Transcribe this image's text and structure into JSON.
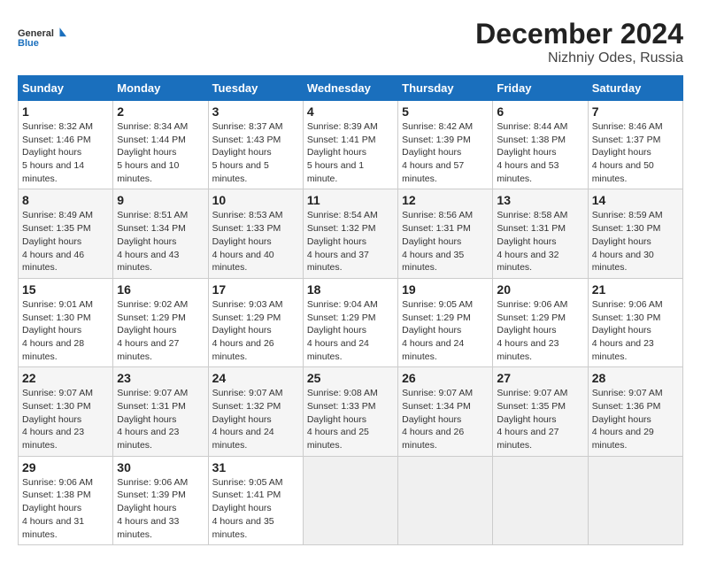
{
  "logo": {
    "line1": "General",
    "line2": "Blue"
  },
  "title": "December 2024",
  "subtitle": "Nizhniy Odes, Russia",
  "weekdays": [
    "Sunday",
    "Monday",
    "Tuesday",
    "Wednesday",
    "Thursday",
    "Friday",
    "Saturday"
  ],
  "weeks": [
    [
      {
        "day": "1",
        "sunrise": "8:32 AM",
        "sunset": "1:46 PM",
        "daylight": "5 hours and 14 minutes."
      },
      {
        "day": "2",
        "sunrise": "8:34 AM",
        "sunset": "1:44 PM",
        "daylight": "5 hours and 10 minutes."
      },
      {
        "day": "3",
        "sunrise": "8:37 AM",
        "sunset": "1:43 PM",
        "daylight": "5 hours and 5 minutes."
      },
      {
        "day": "4",
        "sunrise": "8:39 AM",
        "sunset": "1:41 PM",
        "daylight": "5 hours and 1 minute."
      },
      {
        "day": "5",
        "sunrise": "8:42 AM",
        "sunset": "1:39 PM",
        "daylight": "4 hours and 57 minutes."
      },
      {
        "day": "6",
        "sunrise": "8:44 AM",
        "sunset": "1:38 PM",
        "daylight": "4 hours and 53 minutes."
      },
      {
        "day": "7",
        "sunrise": "8:46 AM",
        "sunset": "1:37 PM",
        "daylight": "4 hours and 50 minutes."
      }
    ],
    [
      {
        "day": "8",
        "sunrise": "8:49 AM",
        "sunset": "1:35 PM",
        "daylight": "4 hours and 46 minutes."
      },
      {
        "day": "9",
        "sunrise": "8:51 AM",
        "sunset": "1:34 PM",
        "daylight": "4 hours and 43 minutes."
      },
      {
        "day": "10",
        "sunrise": "8:53 AM",
        "sunset": "1:33 PM",
        "daylight": "4 hours and 40 minutes."
      },
      {
        "day": "11",
        "sunrise": "8:54 AM",
        "sunset": "1:32 PM",
        "daylight": "4 hours and 37 minutes."
      },
      {
        "day": "12",
        "sunrise": "8:56 AM",
        "sunset": "1:31 PM",
        "daylight": "4 hours and 35 minutes."
      },
      {
        "day": "13",
        "sunrise": "8:58 AM",
        "sunset": "1:31 PM",
        "daylight": "4 hours and 32 minutes."
      },
      {
        "day": "14",
        "sunrise": "8:59 AM",
        "sunset": "1:30 PM",
        "daylight": "4 hours and 30 minutes."
      }
    ],
    [
      {
        "day": "15",
        "sunrise": "9:01 AM",
        "sunset": "1:30 PM",
        "daylight": "4 hours and 28 minutes."
      },
      {
        "day": "16",
        "sunrise": "9:02 AM",
        "sunset": "1:29 PM",
        "daylight": "4 hours and 27 minutes."
      },
      {
        "day": "17",
        "sunrise": "9:03 AM",
        "sunset": "1:29 PM",
        "daylight": "4 hours and 26 minutes."
      },
      {
        "day": "18",
        "sunrise": "9:04 AM",
        "sunset": "1:29 PM",
        "daylight": "4 hours and 24 minutes."
      },
      {
        "day": "19",
        "sunrise": "9:05 AM",
        "sunset": "1:29 PM",
        "daylight": "4 hours and 24 minutes."
      },
      {
        "day": "20",
        "sunrise": "9:06 AM",
        "sunset": "1:29 PM",
        "daylight": "4 hours and 23 minutes."
      },
      {
        "day": "21",
        "sunrise": "9:06 AM",
        "sunset": "1:30 PM",
        "daylight": "4 hours and 23 minutes."
      }
    ],
    [
      {
        "day": "22",
        "sunrise": "9:07 AM",
        "sunset": "1:30 PM",
        "daylight": "4 hours and 23 minutes."
      },
      {
        "day": "23",
        "sunrise": "9:07 AM",
        "sunset": "1:31 PM",
        "daylight": "4 hours and 23 minutes."
      },
      {
        "day": "24",
        "sunrise": "9:07 AM",
        "sunset": "1:32 PM",
        "daylight": "4 hours and 24 minutes."
      },
      {
        "day": "25",
        "sunrise": "9:08 AM",
        "sunset": "1:33 PM",
        "daylight": "4 hours and 25 minutes."
      },
      {
        "day": "26",
        "sunrise": "9:07 AM",
        "sunset": "1:34 PM",
        "daylight": "4 hours and 26 minutes."
      },
      {
        "day": "27",
        "sunrise": "9:07 AM",
        "sunset": "1:35 PM",
        "daylight": "4 hours and 27 minutes."
      },
      {
        "day": "28",
        "sunrise": "9:07 AM",
        "sunset": "1:36 PM",
        "daylight": "4 hours and 29 minutes."
      }
    ],
    [
      {
        "day": "29",
        "sunrise": "9:06 AM",
        "sunset": "1:38 PM",
        "daylight": "4 hours and 31 minutes."
      },
      {
        "day": "30",
        "sunrise": "9:06 AM",
        "sunset": "1:39 PM",
        "daylight": "4 hours and 33 minutes."
      },
      {
        "day": "31",
        "sunrise": "9:05 AM",
        "sunset": "1:41 PM",
        "daylight": "4 hours and 35 minutes."
      },
      null,
      null,
      null,
      null
    ]
  ]
}
